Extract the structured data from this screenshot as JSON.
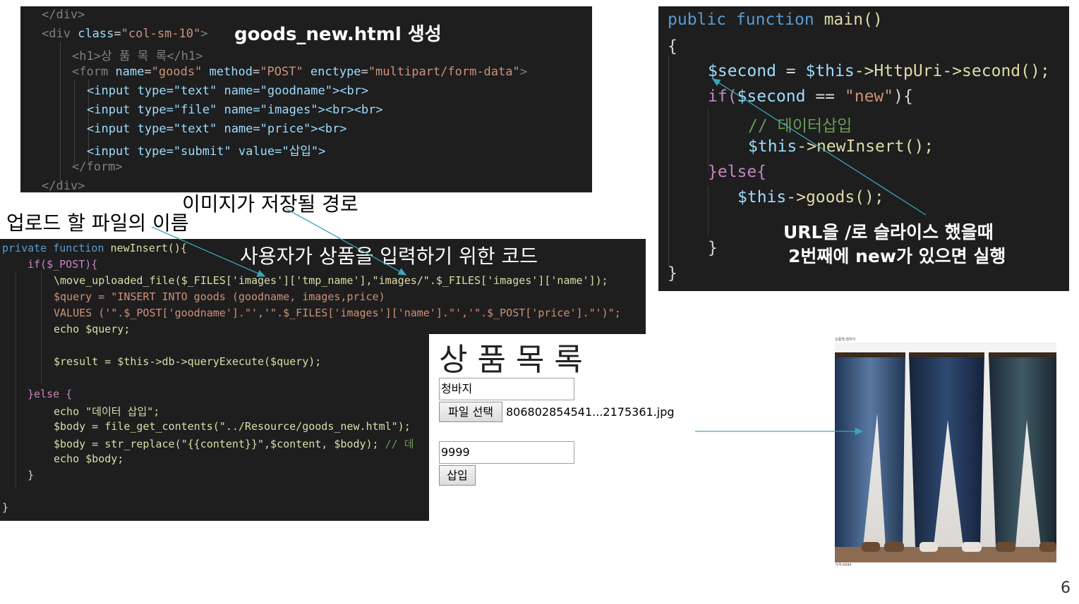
{
  "panel_html": {
    "title_overlay": "goods_new.html 생성",
    "lines": {
      "l1_close_div": "</div>",
      "l2_div_open": "<div",
      "l2_attr": "class",
      "l2_val": "\"col-sm-10\"",
      "l3_h1": "<h1>상 품 목 록</h1>",
      "l4_form": "<form",
      "l4_name": "name",
      "l4_name_val": "\"goods\"",
      "l4_method": "method",
      "l4_method_val": "\"POST\"",
      "l4_enctype": "enctype",
      "l4_enctype_val": "\"multipart/form-data\"",
      "l5": "<input type=\"text\" name=\"goodname\"><br>",
      "l6": "<input type=\"file\" name=\"images\"><br><br>",
      "l7": "<input type=\"text\" name=\"price\"><br>",
      "l8": "<input type=\"submit\" value=\"삽입\">",
      "l9": "</form>",
      "l10": "</div>"
    }
  },
  "panel_main": {
    "l1_kw": "public function",
    "l1_fn": "main()",
    "l2": "{",
    "l3_var": "$second",
    "l3_rest": " = ",
    "l3_this": "$this",
    "l3_call": "->HttpUri->second();",
    "l4_if": "if(",
    "l4_var": "$second",
    "l4_eq": " == ",
    "l4_str": "\"new\"",
    "l4_end": "){",
    "l5_comment": "// 데이터삽입",
    "l6_this": "$this",
    "l6_call": "->newInsert();",
    "l7_else": "}else{",
    "l8_this": "$this",
    "l8_call": "->goods();",
    "l9": "}",
    "l10": "}",
    "note_line1": "URL을 /로 슬라이스 했을때",
    "note_line2": "2번째에 new가 있으면 실행"
  },
  "annotations": {
    "upload_name": "업로드 할 파일의 이름",
    "image_path": "이미지가 저장될 경로",
    "user_input_code": "사용자가 상품을 입력하기 위한 코드"
  },
  "panel_php": {
    "l1_kw": "private function",
    "l1_fn": "newInsert(){",
    "l2": "if($_POST){",
    "l3": "\\move_uploaded_file($_FILES['images']['tmp_name'],\"images/\".$_FILES['images']['name']);",
    "l4": "$query = \"INSERT INTO goods (goodname, images,price)",
    "l5": "VALUES ('\".$_POST['goodname'].\"','\".$_FILES['images']['name'].\"','\".$_POST['price'].\"')\";",
    "l6": "echo $query;",
    "l7": "$result = $this->db->queryExecute($query);",
    "l8": "}else {",
    "l9": "echo \"데이터 삽입\";",
    "l10": "$body = file_get_contents(\"../Resource/goods_new.html\");",
    "l11_code": "$body = str_replace(\"{{content}}\",$content, $body);",
    "l11_comment": " // 데",
    "l12": "echo $body;",
    "l13": "}",
    "l14": "}"
  },
  "form_preview": {
    "heading": "상 품 목 록",
    "name_value": "청바지",
    "file_button": "파일 선택",
    "file_name": "806802854541...2175361.jpg",
    "price_value": "9999",
    "submit_label": "삽입"
  },
  "product_image": {
    "caption_top": "상품명:청바지",
    "caption_bottom": "가격:9999"
  },
  "page_number": "6",
  "colors": {
    "code_bg": "#1e1e1e",
    "arrow": "#3aa6b9"
  }
}
